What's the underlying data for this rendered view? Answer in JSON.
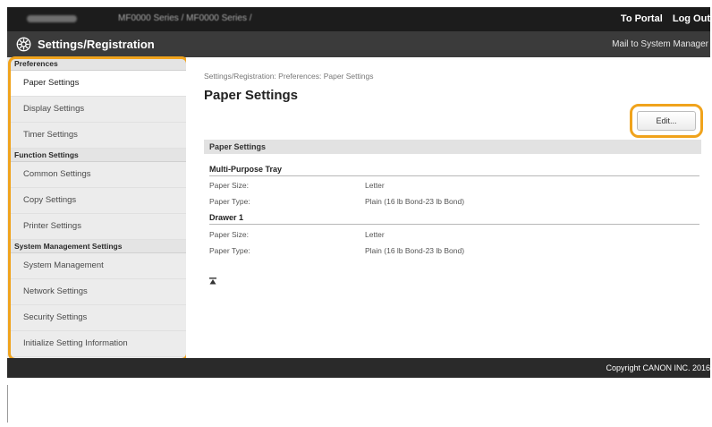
{
  "header": {
    "model": "MF0000 Series / MF0000 Series /",
    "to_portal": "To Portal",
    "log_out": "Log Out"
  },
  "titlebar": {
    "title": "Settings/Registration",
    "mail": "Mail to System Manager",
    "icon": "gear-icon"
  },
  "sidebar": {
    "sections": [
      {
        "heading": "Preferences",
        "items": [
          {
            "label": "Paper Settings",
            "active": true
          },
          {
            "label": "Display Settings",
            "active": false
          },
          {
            "label": "Timer Settings",
            "active": false
          }
        ]
      },
      {
        "heading": "Function Settings",
        "items": [
          {
            "label": "Common Settings",
            "active": false
          },
          {
            "label": "Copy Settings",
            "active": false
          },
          {
            "label": "Printer Settings",
            "active": false
          }
        ]
      },
      {
        "heading": "System Management Settings",
        "items": [
          {
            "label": "System Management",
            "active": false
          },
          {
            "label": "Network Settings",
            "active": false
          },
          {
            "label": "Security Settings",
            "active": false
          },
          {
            "label": "Initialize Setting Information",
            "active": false
          }
        ]
      }
    ]
  },
  "main": {
    "breadcrumb": "Settings/Registration: Preferences: Paper Settings",
    "title": "Paper Settings",
    "edit_label": "Edit...",
    "section_label": "Paper Settings",
    "groups": [
      {
        "title": "Multi-Purpose Tray",
        "rows": [
          {
            "key": "Paper Size:",
            "value": "Letter"
          },
          {
            "key": "Paper Type:",
            "value": "Plain (16 lb Bond-23 lb Bond)"
          }
        ]
      },
      {
        "title": "Drawer 1",
        "rows": [
          {
            "key": "Paper Size:",
            "value": "Letter"
          },
          {
            "key": "Paper Type:",
            "value": "Plain (16 lb Bond-23 lb Bond)"
          }
        ]
      }
    ]
  },
  "footer": {
    "copyright": "Copyright CANON INC. 2016"
  },
  "colors": {
    "highlight": "#f0a31c",
    "topbar": "#1c1c1c",
    "titlebar": "#3b3b3b"
  }
}
